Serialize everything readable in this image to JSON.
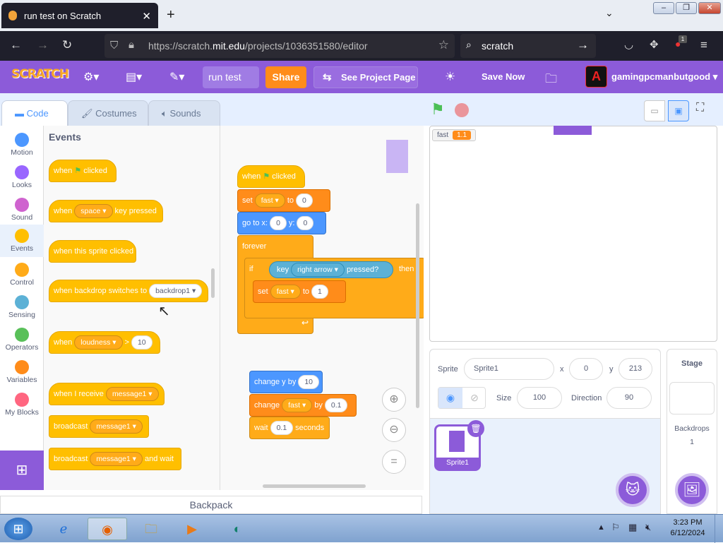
{
  "browser": {
    "tab_title": "run test on Scratch",
    "url_prefix": "https://scratch.",
    "url_domain": "mit.edu",
    "url_path": "/projects/1036351580/editor",
    "search_text": "scratch",
    "notification_count": "1"
  },
  "menubar": {
    "logo": "SCRATCH",
    "project_title": "run test",
    "share": "Share",
    "see_project": "See Project Page",
    "save_now": "Save Now",
    "username": "gamingpcmanbutgood"
  },
  "tabs": {
    "code": "Code",
    "costumes": "Costumes",
    "sounds": "Sounds"
  },
  "categories": [
    {
      "label": "Motion",
      "color": "#4c97ff"
    },
    {
      "label": "Looks",
      "color": "#9966ff"
    },
    {
      "label": "Sound",
      "color": "#cf63cf"
    },
    {
      "label": "Events",
      "color": "#ffbf00"
    },
    {
      "label": "Control",
      "color": "#ffab19"
    },
    {
      "label": "Sensing",
      "color": "#5cb1d6"
    },
    {
      "label": "Operators",
      "color": "#59c059"
    },
    {
      "label": "Variables",
      "color": "#ff8c1a"
    },
    {
      "label": "My Blocks",
      "color": "#ff6680"
    }
  ],
  "palette": {
    "heading": "Events",
    "when_flag_a": "when",
    "when_flag_b": "clicked",
    "when_key_a": "when",
    "when_key_dd": "space",
    "when_key_b": "key pressed",
    "sprite_clicked": "when this sprite clicked",
    "backdrop_a": "when backdrop switches to",
    "backdrop_dd": "backdrop1",
    "loud_a": "when",
    "loud_dd": "loudness",
    "loud_op": ">",
    "loud_val": "10",
    "receive_a": "when I receive",
    "receive_dd": "message1",
    "broadcast_a": "broadcast",
    "broadcast_dd": "message1",
    "bwait_a": "broadcast",
    "bwait_dd": "message1",
    "bwait_b": "and wait"
  },
  "script": {
    "hat_a": "when",
    "hat_b": "clicked",
    "set1_a": "set",
    "set1_var": "fast",
    "set1_b": "to",
    "set1_val": "0",
    "goto_a": "go to x:",
    "goto_x": "0",
    "goto_b": "y:",
    "goto_y": "0",
    "forever": "forever",
    "if": "if",
    "key_a": "key",
    "key_dd": "right arrow",
    "key_b": "pressed?",
    "then": "then",
    "set2_a": "set",
    "set2_var": "fast",
    "set2_b": "to",
    "set2_val": "1",
    "changey_a": "change y by",
    "changey_val": "10",
    "change_a": "change",
    "change_var": "fast",
    "change_b": "by",
    "change_val": "0.1",
    "wait_a": "wait",
    "wait_val": "0.1",
    "wait_b": "seconds"
  },
  "backpack": "Backpack",
  "stage": {
    "monitor_label": "fast",
    "monitor_value": "1.1"
  },
  "sprite_info": {
    "sprite_label": "Sprite",
    "sprite_name": "Sprite1",
    "x_label": "x",
    "x_value": "0",
    "y_label": "y",
    "y_value": "213",
    "show_label": "Show",
    "size_label": "Size",
    "size_value": "100",
    "direction_label": "Direction",
    "direction_value": "90"
  },
  "sprite_list": [
    {
      "name": "Sprite1"
    }
  ],
  "stage_pane": {
    "title": "Stage",
    "backdrops_label": "Backdrops",
    "backdrops_count": "1"
  },
  "taskbar": {
    "time": "3:23 PM",
    "date": "6/12/2024"
  }
}
